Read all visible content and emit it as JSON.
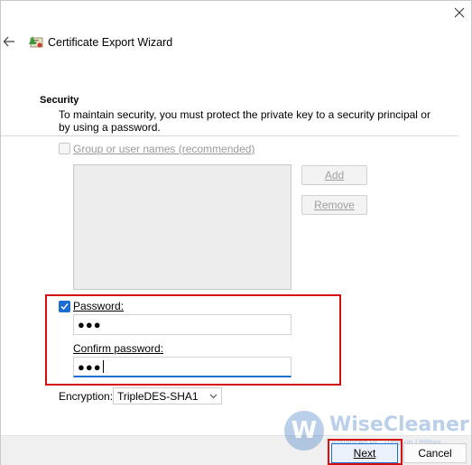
{
  "window": {
    "title": "Certificate Export Wizard"
  },
  "security": {
    "heading": "Security",
    "description": "To maintain security, you must protect the private key to a security principal or by using a password."
  },
  "group": {
    "label": "Group or user names (recommended)",
    "checked": false,
    "enabled": false
  },
  "buttons": {
    "add": "Add",
    "remove": "Remove",
    "next": "Next",
    "cancel": "Cancel"
  },
  "password": {
    "label": "Password:",
    "checked": true,
    "value": "●●●",
    "confirm_label": "Confirm password:",
    "confirm_value": "●●●"
  },
  "encryption": {
    "label": "Encryption:",
    "selected": "TripleDES-SHA1"
  },
  "watermark": {
    "logo_letter": "W",
    "brand": "WiseCleaner",
    "tagline": "Advanced PC Tune-up Utilities"
  },
  "colors": {
    "accent": "#1c6fd1",
    "highlight": "#d80f0f"
  }
}
